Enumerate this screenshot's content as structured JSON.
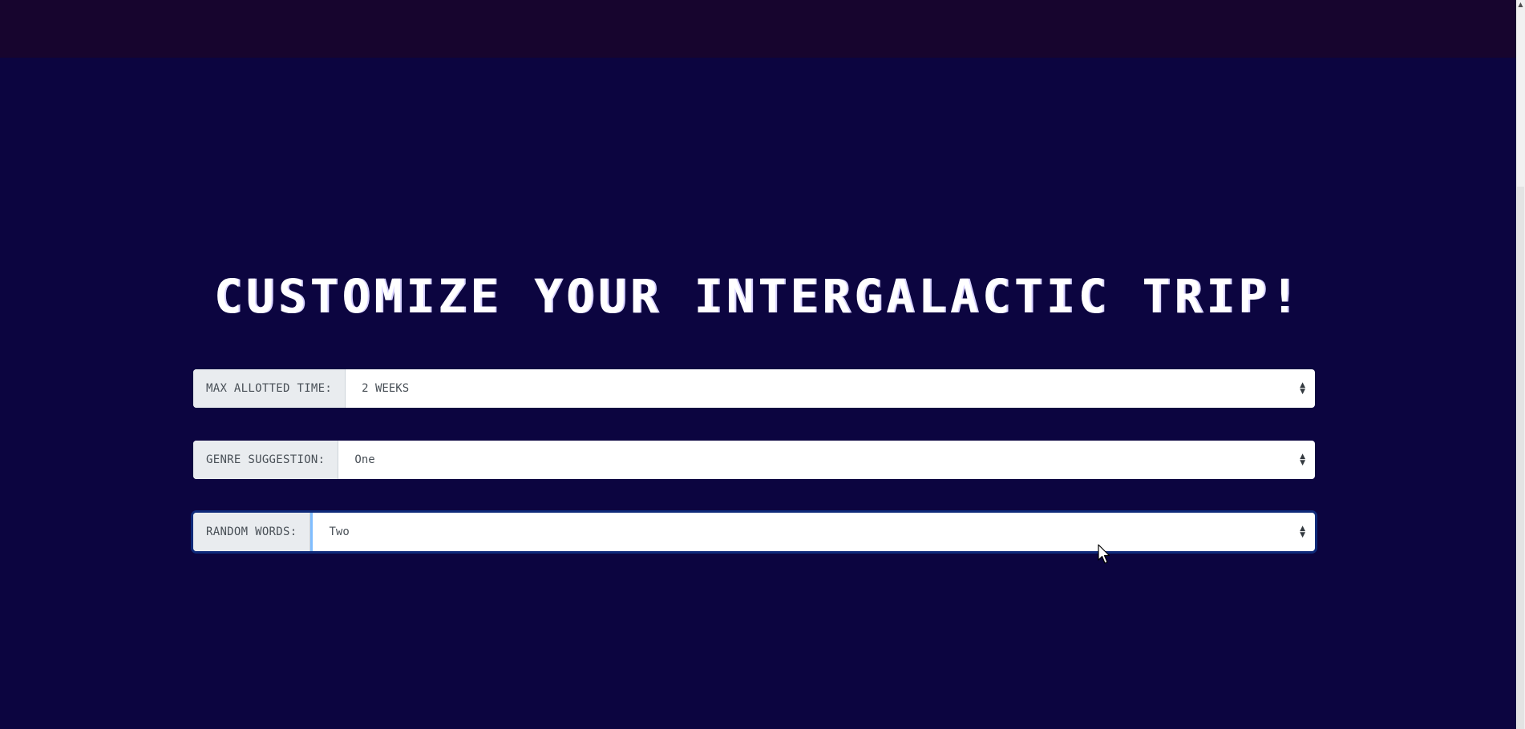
{
  "page": {
    "title": "CUSTOMIZE YOUR INTERGALACTIC TRIP!"
  },
  "form": {
    "fields": [
      {
        "label": "MAX ALLOTTED TIME:",
        "value": "2 WEEKS"
      },
      {
        "label": "GENRE SUGGESTION:",
        "value": "One"
      },
      {
        "label": "RANDOM WORDS:",
        "value": "Two"
      }
    ]
  },
  "colors": {
    "background": "#0c0540",
    "topbar": "#17052e",
    "heading": "#ffffff",
    "focus_ring": "#0e2a7a"
  },
  "icons": {
    "select_caret": "sort-caret-icon",
    "cursor": "mouse-pointer-icon"
  }
}
